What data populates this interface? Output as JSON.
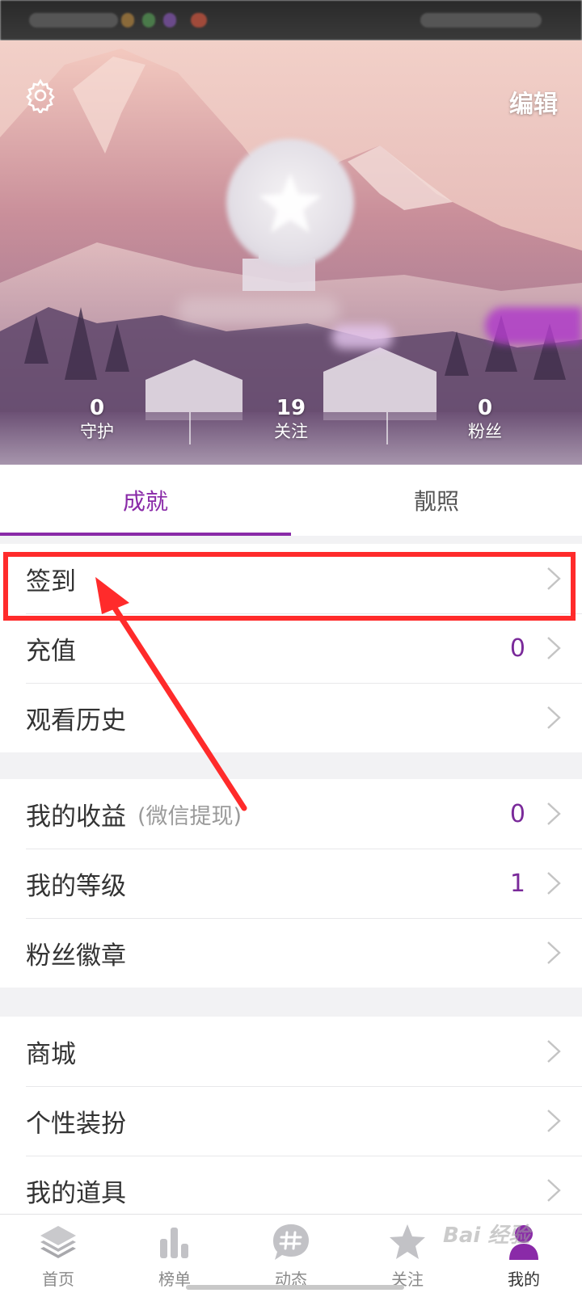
{
  "header": {
    "edit_label": "编辑",
    "stats": [
      {
        "value": "0",
        "label": "守护"
      },
      {
        "value": "19",
        "label": "关注"
      },
      {
        "value": "0",
        "label": "粉丝"
      }
    ]
  },
  "tabs": [
    {
      "label": "成就",
      "active": true
    },
    {
      "label": "靓照",
      "active": false
    }
  ],
  "groups": [
    {
      "items": [
        {
          "label": "签到",
          "hint": "",
          "value": ""
        },
        {
          "label": "充值",
          "hint": "",
          "value": "0"
        },
        {
          "label": "观看历史",
          "hint": "",
          "value": ""
        }
      ]
    },
    {
      "items": [
        {
          "label": "我的收益",
          "hint": "(微信提现)",
          "value": "0"
        },
        {
          "label": "我的等级",
          "hint": "",
          "value": "1"
        },
        {
          "label": "粉丝徽章",
          "hint": "",
          "value": ""
        }
      ]
    },
    {
      "items": [
        {
          "label": "商城",
          "hint": "",
          "value": ""
        },
        {
          "label": "个性装扮",
          "hint": "",
          "value": ""
        },
        {
          "label": "我的道具",
          "hint": "",
          "value": ""
        }
      ]
    }
  ],
  "bottom_nav": [
    {
      "label": "首页",
      "icon": "layers-icon"
    },
    {
      "label": "榜单",
      "icon": "bar-chart-icon"
    },
    {
      "label": "动态",
      "icon": "hashtag-bubble-icon"
    },
    {
      "label": "关注",
      "icon": "star-icon"
    },
    {
      "label": "我的",
      "icon": "person-icon",
      "active": true
    }
  ],
  "watermark": "Bai 经验",
  "colors": {
    "accent": "#8a2aa8",
    "value_purple": "#7a2a9a",
    "annotation_red": "#ff2b2b"
  }
}
